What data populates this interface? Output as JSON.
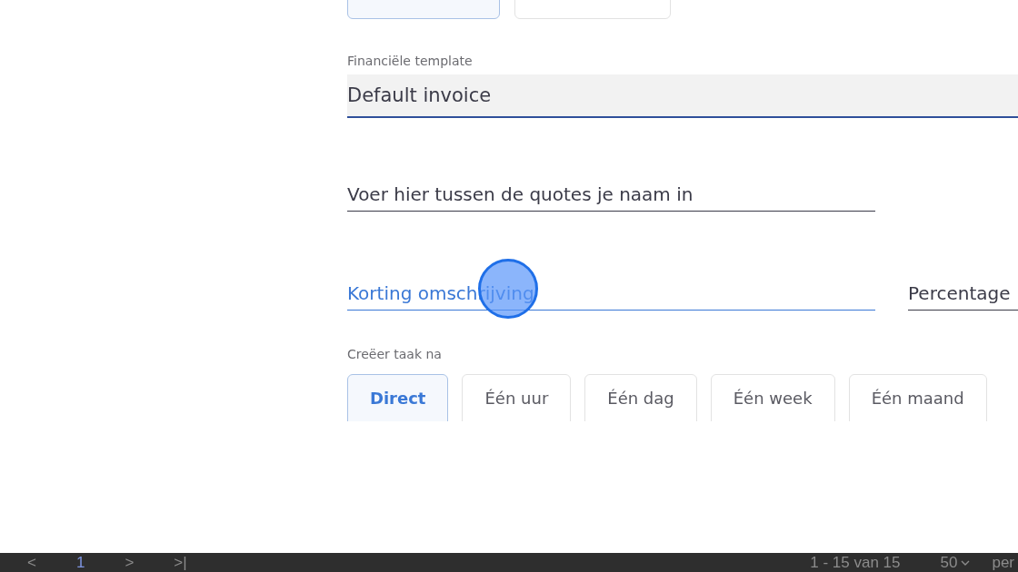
{
  "top_options": [
    {
      "selected": true
    },
    {
      "selected": false
    }
  ],
  "template_field": {
    "label": "Financiële template",
    "value": "Default invoice"
  },
  "name_field": {
    "placeholder": "Voer hier tussen de quotes je naam in",
    "focused": false
  },
  "discount_field": {
    "placeholder": "Korting omschrijving",
    "focused": true
  },
  "percentage_field": {
    "placeholder": "Percentage",
    "focused": false
  },
  "task_delay": {
    "label": "Creëer taak na",
    "options": [
      {
        "label": "Direct",
        "selected": true
      },
      {
        "label": "Één uur",
        "selected": false
      },
      {
        "label": "Één dag",
        "selected": false
      },
      {
        "label": "Één week",
        "selected": false
      },
      {
        "label": "Één maand",
        "selected": false
      }
    ]
  },
  "pagination": {
    "prev": "<",
    "page": "1",
    "next": ">",
    "last": ">|",
    "range": "1 - 15 van 15",
    "page_size": "50",
    "per": "per"
  }
}
